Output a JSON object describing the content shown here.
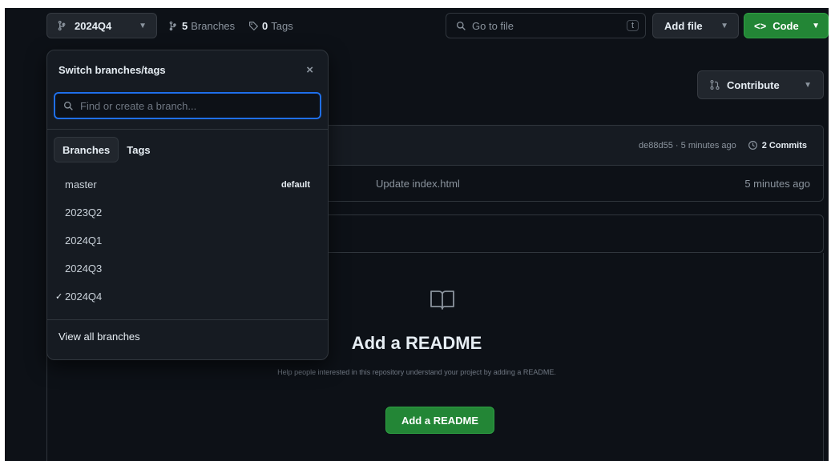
{
  "toolbar": {
    "branch": "2024Q4",
    "branches_count": "5",
    "branches_label": "Branches",
    "tags_count": "0",
    "tags_label": "Tags",
    "search_placeholder": "Go to file",
    "search_shortcut": "t",
    "add_file_label": "Add file",
    "code_label": "Code"
  },
  "repo": {
    "contribute_label": "Contribute",
    "commit_hash_time": "de88d55 · 5 minutes ago",
    "commits_label": "2 Commits",
    "file_row": {
      "message": "Update index.html",
      "time": "5 minutes ago"
    },
    "readme": {
      "title": "Add a README",
      "subtitle": "Help people interested in this repository understand your project by adding a README.",
      "button": "Add a README"
    }
  },
  "dropdown": {
    "title": "Switch branches/tags",
    "close": "×",
    "search_placeholder": "Find or create a branch...",
    "tabs": [
      "Branches",
      "Tags"
    ],
    "branches": [
      {
        "name": "master",
        "badge": "default",
        "selected": false
      },
      {
        "name": "2023Q2",
        "badge": "",
        "selected": false
      },
      {
        "name": "2024Q1",
        "badge": "",
        "selected": false
      },
      {
        "name": "2024Q3",
        "badge": "",
        "selected": false
      },
      {
        "name": "2024Q4",
        "badge": "",
        "selected": true
      }
    ],
    "footer": "View all branches"
  },
  "colors": {
    "accent_green": "#238636",
    "focus_blue": "#1f6feb",
    "background": "#0d1117"
  }
}
